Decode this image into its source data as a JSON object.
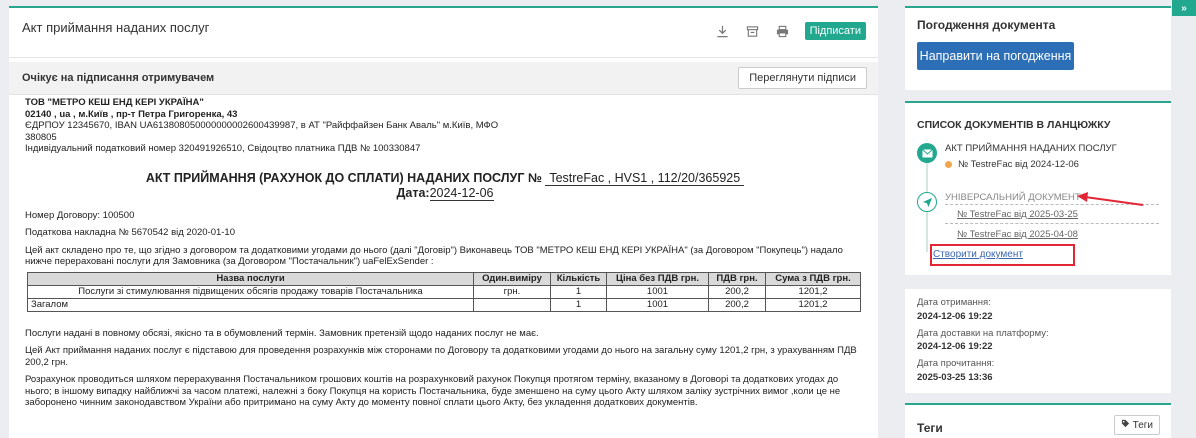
{
  "header": {
    "title": "Акт приймання наданих послуг",
    "sign_button": "Підписати"
  },
  "status": {
    "text": "Очікує на підписання отримувачем",
    "view_button": "Переглянути підписи"
  },
  "document": {
    "company": "ТОВ \"МЕТРО КЕШ ЕНД КЕРІ УКРАЇНА\"",
    "address": "02140 , ua , м.Київ , пр-т Петра Григоренка, 43",
    "bank_line": "ЄДРПОУ 12345670, IBAN UA613808050000000002600439987, в АТ \"Райффайзен Банк Аваль\" м.Київ, МФО",
    "mfo": "380805",
    "tax_line": "Індивідуальний податковий номер 320491926510, Свідоцтво платника ПДВ № 100330847",
    "title": "АКТ ПРИЙМАННЯ (РАХУНОК ДО СПЛАТИ) НАДАНИХ ПОСЛУГ №",
    "number": "TestreFac , HVS1 , 112/20/365925",
    "date_label": "Дата:",
    "date_value": "2024-12-06",
    "contract_no": "Номер Договору: 100500",
    "tax_invoice": "Податкова накладна № 5670542 від 2020-01-10",
    "intro": "Цей акт складено про те, що згідно з договором та додатковими угодами до нього (далі \"Договір\") Виконавець ТОВ \"МЕТРО КЕШ ЕНД КЕРІ УКРАЇНА\" (за Договором \"Покупець\") надало нижче перераховані послуги для Замовника (за Договором \"Постачальник\") uaFelExSender :",
    "table": {
      "headers": [
        "Назва послуги",
        "Один.виміру",
        "Кількість",
        "Ціна без ПДВ грн.",
        "ПДВ грн.",
        "Сума з ПДВ грн."
      ],
      "rows": [
        [
          "Послуги зі стимулювання підвищених обсягів продажу товарів Постачальника",
          "грн.",
          "1",
          "1001",
          "200,2",
          "1201,2"
        ],
        [
          "Загалом",
          "",
          "1",
          "1001",
          "200,2",
          "1201,2"
        ]
      ]
    },
    "p1": "Послуги надані в повному обсязі, якісно та в обумовлений термін. Замовник претензій щодо наданих послуг не має.",
    "p2": "Цей Акт приймання наданих послуг є підставою для проведення розрахунків між сторонами по Договору та додатковими угодами до нього на загальну суму 1201,2 грн, з урахуванням ПДВ 200,2 грн.",
    "p3": "Розрахунок проводиться шляхом перерахування Постачальником грошових коштів на розрахунковий рахунок Покупця протягом терміну, вказаному в Договорі та додаткових угодах до нього; в іншому випадку найближчі за часом платежі, належні з боку Покупця на користь Постачальника, буде зменшено на суму цього Акту шляхом заліку зустрічних вимог ,коли це не заборонено чинним законодавством України або притримано на суму Акту до моменту повної сплати цього Акту, без укладення додаткових документів."
  },
  "approval": {
    "title": "Погодження документа",
    "button": "Направити на погодження"
  },
  "chain": {
    "title": "СПИСОК ДОКУМЕНТІВ В ЛАНЦЮЖКУ",
    "doc1_title": "АКТ ПРИЙМАННЯ НАДАНИХ ПОСЛУГ",
    "doc1_ref": "№ TestreFac від 2024-12-06",
    "doc2_title": "УНІВЕРСАЛЬНИЙ ДОКУМЕНТ",
    "doc2_ref1": "№ TestreFac від 2025-03-25",
    "doc2_ref2": "№ TestreFac від 2025-04-08",
    "create_link": "Створити документ"
  },
  "dates": {
    "received_label": "Дата отримання:",
    "received_value": "2024-12-06 19:22",
    "delivered_label": "Дата доставки на платформу:",
    "delivered_value": "2024-12-06 19:22",
    "read_label": "Дата прочитання:",
    "read_value": "2025-03-25 13:36"
  },
  "tags": {
    "title": "Теги",
    "button": "Теги"
  },
  "colors": {
    "accent": "#21a88f",
    "primary_button": "#2d6fb6",
    "highlight": "#e32636",
    "pending_dot": "#f0a64b"
  }
}
